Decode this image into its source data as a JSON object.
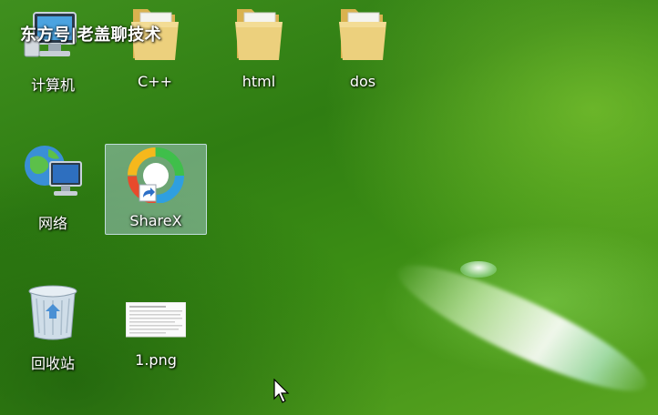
{
  "watermark": "东方号|老盖聊技术",
  "desktop": {
    "icons": [
      {
        "label": "计算机"
      },
      {
        "label": "C++"
      },
      {
        "label": "html"
      },
      {
        "label": "dos"
      },
      {
        "label": "网络"
      },
      {
        "label": "ShareX"
      },
      {
        "label": "回收站"
      },
      {
        "label": "1.png"
      }
    ]
  },
  "colors": {
    "folder": "#e9c96c",
    "selection": "#b9d7eb",
    "wallpaper": "#3b8d14"
  },
  "icon_names": [
    "computer-icon",
    "folder-icon",
    "network-icon",
    "sharex-icon",
    "recycle-bin-icon",
    "image-file-icon",
    "mouse-cursor-icon"
  ]
}
